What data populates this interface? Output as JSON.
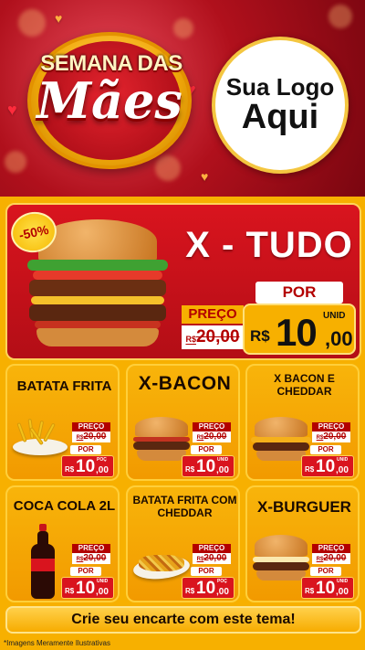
{
  "header": {
    "badge_line1": "SEMANA DAS",
    "badge_line2": "Mães",
    "logo_line1": "Sua Logo",
    "logo_line2": "Aqui"
  },
  "featured": {
    "name": "X - TUDO",
    "discount": "-50%",
    "preco_label": "PREÇO",
    "old_currency": "R$",
    "old_price": "20,00",
    "por_label": "POR",
    "new_currency": "R$",
    "new_price_int": "10",
    "new_price_dec": ",00",
    "unit": "UNID"
  },
  "products": [
    {
      "name": "BATATA FRITA",
      "preco_label": "PREÇO",
      "old_currency": "R$",
      "old_price": "20,00",
      "por_label": "POR",
      "new_currency": "R$",
      "new_price_int": "10",
      "new_price_dec": ",00",
      "unit": "POÇ"
    },
    {
      "name": "X-BACON",
      "preco_label": "PREÇO",
      "old_currency": "R$",
      "old_price": "20,00",
      "por_label": "POR",
      "new_currency": "R$",
      "new_price_int": "10",
      "new_price_dec": ",00",
      "unit": "UNID"
    },
    {
      "name": "X BACON E CHEDDAR",
      "preco_label": "PREÇO",
      "old_currency": "R$",
      "old_price": "20,00",
      "por_label": "POR",
      "new_currency": "R$",
      "new_price_int": "10",
      "new_price_dec": ",00",
      "unit": "UNID"
    },
    {
      "name": "COCA COLA 2L",
      "preco_label": "PREÇO",
      "old_currency": "R$",
      "old_price": "20,00",
      "por_label": "POR",
      "new_currency": "R$",
      "new_price_int": "10",
      "new_price_dec": ",00",
      "unit": "UNID"
    },
    {
      "name": "BATATA FRITA COM CHEDDAR",
      "preco_label": "PREÇO",
      "old_currency": "R$",
      "old_price": "20,00",
      "por_label": "POR",
      "new_currency": "R$",
      "new_price_int": "10",
      "new_price_dec": ",00",
      "unit": "POÇ"
    },
    {
      "name": "X-BURGUER",
      "preco_label": "PREÇO",
      "old_currency": "R$",
      "old_price": "20,00",
      "por_label": "POR",
      "new_currency": "R$",
      "new_price_int": "10",
      "new_price_dec": ",00",
      "unit": "UNID"
    }
  ],
  "cta": "Crie seu encarte com este tema!",
  "footnote": "*Imagens Meramente Ilustrativas",
  "colors": {
    "red": "#d9141e",
    "yellow": "#f7b000",
    "dark_red": "#b30000"
  },
  "icons": [
    "heart-icon",
    "burger-image",
    "fries-image",
    "coke-bottle-image"
  ]
}
